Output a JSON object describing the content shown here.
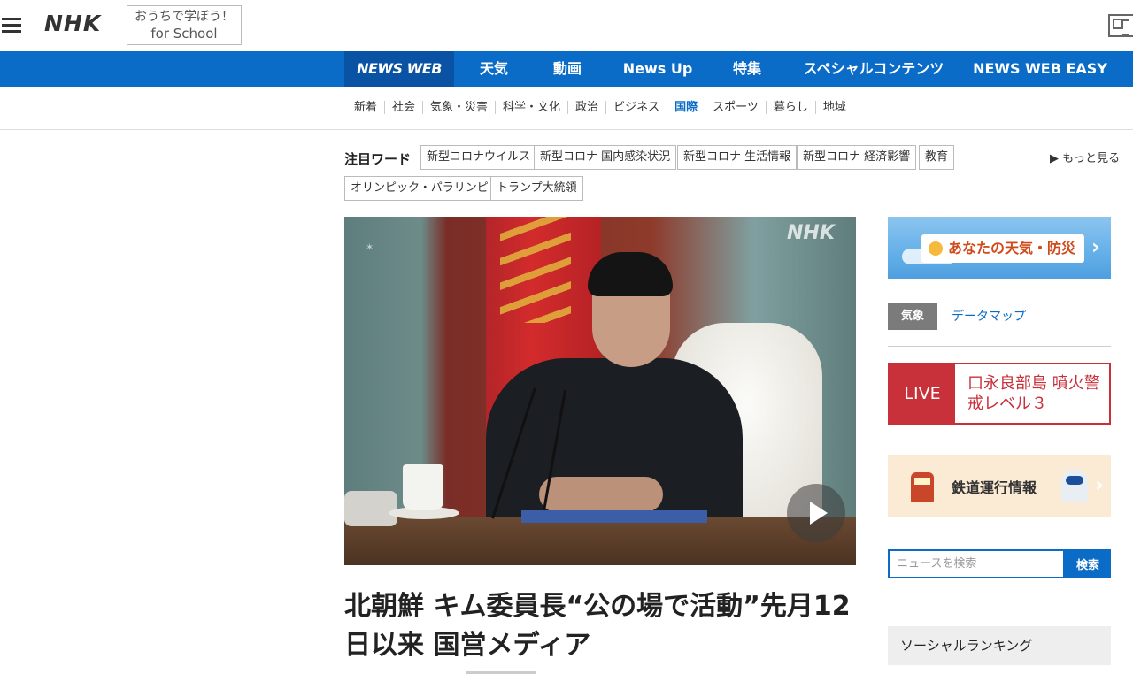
{
  "header": {
    "logo": "NHK",
    "school_line1": "おうちで学ぼう！",
    "school_line2": "for School"
  },
  "bluenav": [
    "NEWS WEB",
    "天気",
    "動画",
    "News Up",
    "特集",
    "スペシャルコンテンツ",
    "NEWS WEB EASY"
  ],
  "catnav": [
    "新着",
    "社会",
    "気象・災害",
    "科学・文化",
    "政治",
    "ビジネス",
    "国際",
    "スポーツ",
    "暮らし",
    "地域"
  ],
  "catnav_current": "国際",
  "trending": {
    "label": "注目ワード",
    "tags": [
      "新型コロナウイルス",
      "新型コロナ 国内感染状況",
      "新型コロナ 生活情報",
      "新型コロナ 経済影響",
      "教育",
      "オリンピック・パラリンピック",
      "トランプ大統領"
    ],
    "more": "▶ もっと見る"
  },
  "main": {
    "watermark": "NHK",
    "headline": "北朝鮮 キム委員長“公の場で活動”先月12日以来 国営メディア"
  },
  "sidebar": {
    "weather_banner": "あなたの天気・防災",
    "kisho_badge": "気象",
    "datamap": "データマップ",
    "live_label": "LIVE",
    "live_text": "口永良部島 噴火警戒レベル３",
    "train": "鉄道運行情報",
    "search_placeholder": "ニュースを検索",
    "search_button": "検索",
    "social_ranking": "ソーシャルランキング"
  }
}
